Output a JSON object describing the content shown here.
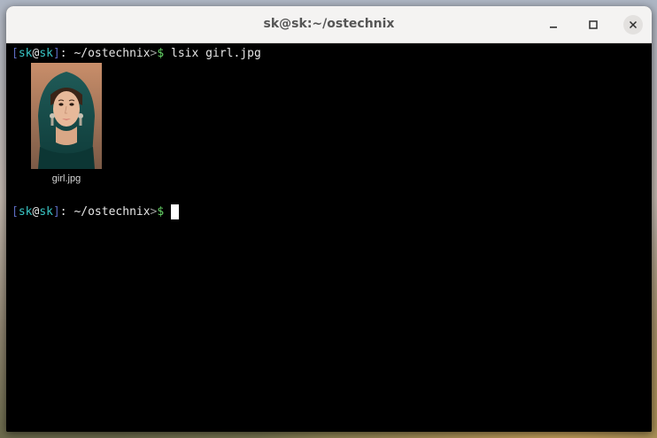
{
  "window": {
    "title": "sk@sk:~/ostechnix"
  },
  "terminal": {
    "prompt": {
      "open_bracket": "[",
      "user": "sk",
      "at": "@",
      "host": "sk",
      "close_bracket": "]",
      "colon": ": ",
      "path": "~/ostechnix",
      "arrow": ">",
      "dollar": "$"
    },
    "command": " lsix girl.jpg",
    "thumbnail": {
      "filename": "girl.jpg"
    }
  },
  "icons": {
    "minimize": "minimize-icon",
    "maximize": "maximize-icon",
    "close": "close-icon"
  },
  "colors": {
    "titlebar": "#f4f3f2",
    "terminal_bg": "#000000",
    "bracket": "#5c6bc0",
    "user_host": "#39c5c5",
    "dollar": "#66d466"
  }
}
